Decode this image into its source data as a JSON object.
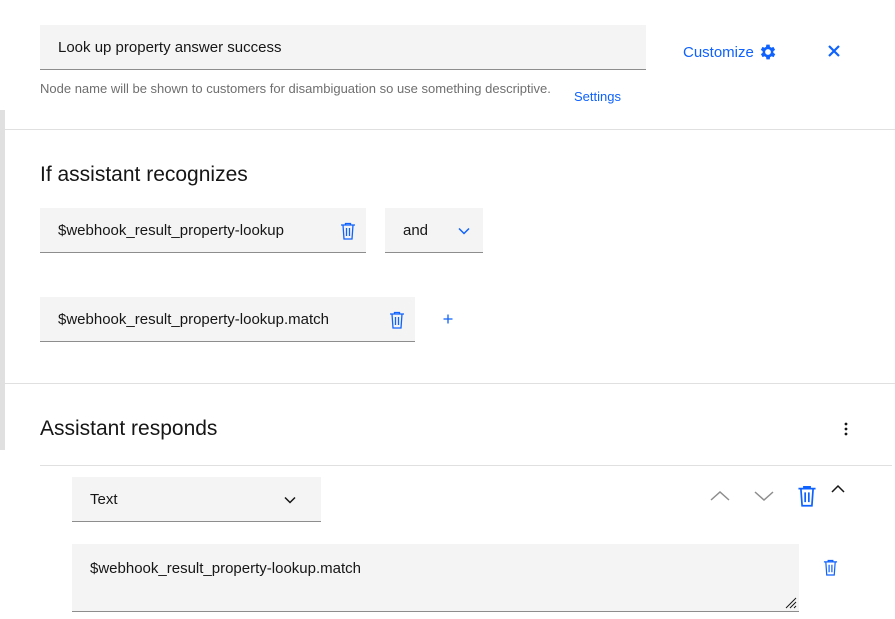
{
  "node": {
    "name_value": "Look up property answer success",
    "helper_text": "Node name will be shown to customers for disambiguation so use something descriptive.",
    "settings_label": "Settings",
    "customize_label": "Customize"
  },
  "conditions": {
    "title": "If assistant recognizes",
    "items": [
      {
        "value": "$webhook_result_property-lookup"
      },
      {
        "value": "$webhook_result_property-lookup.match"
      }
    ],
    "operator": "and"
  },
  "responses": {
    "title": "Assistant responds",
    "type_selected": "Text",
    "text_value": "$webhook_result_property-lookup.match"
  },
  "colors": {
    "accent": "#0f62fe",
    "field_bg": "#f4f4f4",
    "border": "#8d8d8d",
    "helper": "#6f6f6f"
  },
  "icons": [
    "gear-icon",
    "close-icon",
    "trash-icon",
    "chevron-down-icon",
    "plus-icon",
    "overflow-menu-icon",
    "chevron-up-icon",
    "resize-grip-icon"
  ]
}
